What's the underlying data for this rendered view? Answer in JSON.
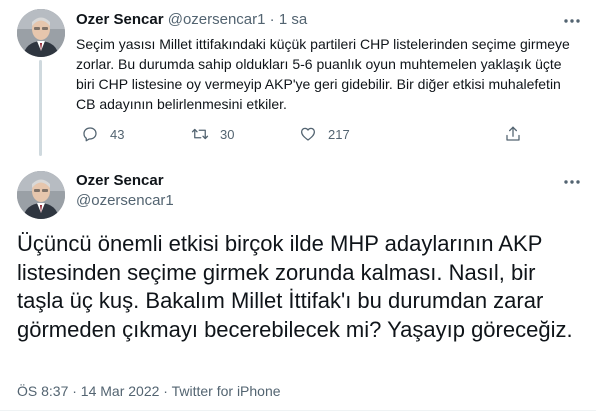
{
  "tweet1": {
    "name": "Ozer Sencar",
    "handle": "@ozersencar1",
    "separator": "·",
    "time": "1 sa",
    "text": "Seçim yasısı Millet ittifakındaki küçük partileri CHP listelerinden seçime girmeye zorlar. Bu durumda sahip oldukları 5-6 puanlık oyun muhtemelen yaklaşık üçte biri CHP listesine oy vermeyip AKP'ye geri gidebilir. Bir diğer etkisi muhalefetin CB adayının belirlenmesini etkiler.",
    "reply_count": "43",
    "retweet_count": "30",
    "like_count": "217"
  },
  "tweet2": {
    "name": "Ozer Sencar",
    "handle": "@ozersencar1",
    "text": "Üçüncü önemli etkisi birçok ilde MHP adaylarının AKP listesinden seçime girmek zorunda kalması. Nasıl,  bir taşla üç kuş. Bakalım Millet İttifak'ı bu durumdan zarar görmeden çıkmayı becerebilecek mi? Yaşayıp göreceğiz.",
    "meta": "ÖS 8:37 · 14 Mar 2022 · Twitter for iPhone"
  },
  "icons": {
    "more": "more-horizontal-icon",
    "reply": "reply-icon",
    "retweet": "retweet-icon",
    "like": "heart-icon",
    "share": "share-icon"
  },
  "colors": {
    "text_primary": "#0f1419",
    "text_secondary": "#536471",
    "connector": "#cfd9de"
  }
}
